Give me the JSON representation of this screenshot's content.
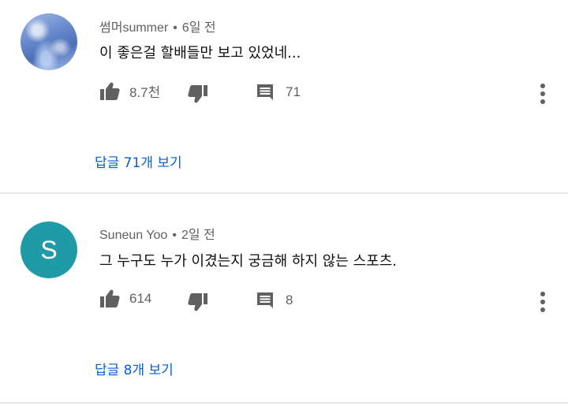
{
  "comments": [
    {
      "author": "썸머summer",
      "separator": "•",
      "time": "6일 전",
      "text": "이 좋은걸 할배들만 보고 있었네...",
      "likes": "8.7천",
      "reply_count": "71",
      "view_replies": "답글 71개 보기",
      "avatar_type": "photo"
    },
    {
      "author": "Suneun Yoo",
      "separator": "•",
      "time": "2일 전",
      "text": "그 누구도 누가 이겼는지 궁금해 하지 않는 스포츠.",
      "likes": "614",
      "reply_count": "8",
      "view_replies": "답글 8개 보기",
      "avatar_type": "letter",
      "avatar_letter": "S",
      "avatar_color": "#1f9aa7"
    }
  ],
  "colors": {
    "link": "#065fd4",
    "meta": "#606060",
    "icon": "#606060",
    "text": "#0f0f0f",
    "divider": "#e6e6e6"
  },
  "icons": [
    "thumbs-up-icon",
    "thumbs-down-icon",
    "reply-comment-icon",
    "more-vert-icon"
  ]
}
